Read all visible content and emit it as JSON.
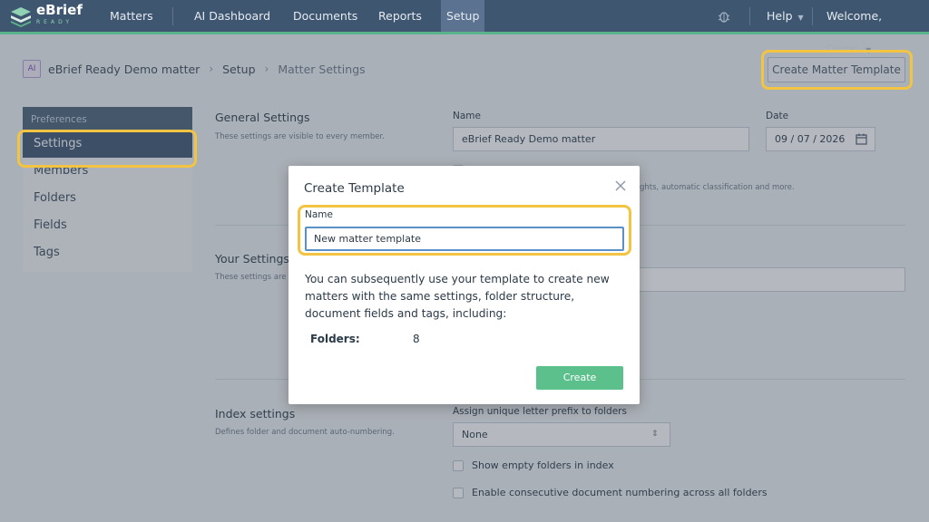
{
  "nav": {
    "logo_text": "eBrief",
    "logo_sub": "READY",
    "items": [
      "Matters",
      "AI Dashboard",
      "Documents",
      "Reports",
      "Setup"
    ],
    "help": "Help",
    "welcome": "Welcome, Demo"
  },
  "breadcrumb": {
    "badge": "AI",
    "matter": "eBrief Ready Demo matter",
    "setup": "Setup",
    "current": "Matter Settings"
  },
  "actions": {
    "create_template": "Create Matter Template"
  },
  "sidebar": {
    "heading": "Preferences",
    "items": [
      "Settings",
      "Members",
      "Folders",
      "Fields",
      "Tags"
    ],
    "active": "Settings"
  },
  "general": {
    "title": "General Settings",
    "subtitle": "These settings are visible to every member.",
    "name_label": "Name",
    "name_value": "eBrief Ready Demo matter",
    "date_label": "Date",
    "date_value": "09 / 07 / 2026",
    "partial_text": "ghts, automatic classification and more."
  },
  "your_settings": {
    "title": "Your Settings",
    "subtitle_partial": "These settings are v"
  },
  "index": {
    "title": "Index settings",
    "subtitle": "Defines folder and document auto-numbering.",
    "prefix_label": "Assign unique letter prefix to folders",
    "prefix_value": "None",
    "show_empty": "Show empty folders in index",
    "consecutive": "Enable consecutive document numbering across all folders"
  },
  "modal": {
    "title": "Create Template",
    "name_label": "Name",
    "name_value": "New matter template",
    "description": "You can subsequently use your template to create new matters with the same settings, folder structure, document fields and tags, including:",
    "folders_label": "Folders:",
    "folders_value": "8",
    "create_label": "Create"
  },
  "colors": {
    "nav_bg": "#3f5670",
    "accent_green": "#5bc08c",
    "highlight": "#f3c342",
    "input_focus": "#5b8fc7"
  }
}
